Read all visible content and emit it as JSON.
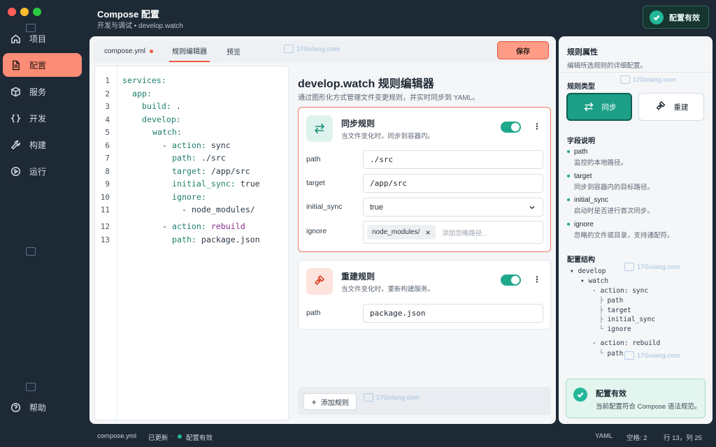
{
  "window": {
    "title": "Compose 配置",
    "subtitle": "开发与调试 • develop.watch"
  },
  "header": {
    "valid_label": "配置有效"
  },
  "sidebar": {
    "items": [
      {
        "label": "项目",
        "icon": "home-icon"
      },
      {
        "label": "配置",
        "icon": "document-icon"
      },
      {
        "label": "服务",
        "icon": "cube-icon"
      },
      {
        "label": "开发",
        "icon": "code-braces-icon"
      },
      {
        "label": "构建",
        "icon": "wrench-icon"
      },
      {
        "label": "运行",
        "icon": "play-circle-icon"
      }
    ],
    "help": "帮助"
  },
  "tabs": {
    "file": "compose.yml",
    "rules": "规则编辑器",
    "preview": "预览",
    "save": "保存"
  },
  "code": {
    "lines": [
      "1",
      "2",
      "3",
      "4",
      "5",
      "6",
      "7",
      "8",
      "9",
      "10",
      "11",
      "12",
      "13"
    ],
    "l1": "services:",
    "l2": "app:",
    "l3k": "build:",
    "l3v": " .",
    "l4": "develop:",
    "l5": "watch:",
    "l6a": "- ",
    "l6k": "action:",
    "l6v": " sync",
    "l7k": "path:",
    "l7v": " ./src",
    "l8k": "target:",
    "l8v": " /app/src",
    "l9k": "initial_sync:",
    "l9v": " true",
    "l10k": "ignore:",
    "l11": "- node_modules/",
    "l12a": "- ",
    "l12k": "action:",
    "l12v": " rebuild",
    "l13k": "path:",
    "l13v": " package.json"
  },
  "rules": {
    "title": "develop.watch 规则编辑器",
    "subtitle": "通过图形化方式管理文件变更规则，并实时同步到 YAML。",
    "sync": {
      "title": "同步规则",
      "desc": "当文件变化时，同步到容器内。",
      "enabled": true,
      "path_label": "path",
      "path": "./src",
      "target_label": "target",
      "target": "/app/src",
      "initial_sync_label": "initial_sync",
      "initial_sync": "true",
      "ignore_label": "ignore",
      "ignore_chip": "node_modules/",
      "ignore_placeholder": "添加忽略路径..."
    },
    "rebuild": {
      "title": "重建规则",
      "desc": "当文件变化时，重新构建服务。",
      "enabled": true,
      "path_label": "path",
      "path": "package.json"
    },
    "add": "添加规则"
  },
  "props": {
    "title": "规则属性",
    "subtitle": "编辑所选规则的详细配置。",
    "type_label": "规则类型",
    "type_sync": "同步",
    "type_rebuild": "重建",
    "fields_label": "字段说明",
    "fields": [
      {
        "name": "path",
        "desc": "监控的本地路径。"
      },
      {
        "name": "target",
        "desc": "同步到容器内的目标路径。"
      },
      {
        "name": "initial_sync",
        "desc": "启动时是否进行首次同步。"
      },
      {
        "name": "ignore",
        "desc": "忽略的文件或目录，支持通配符。"
      }
    ],
    "structure_label": "配置结构",
    "tree": {
      "develop": "develop",
      "watch": "watch",
      "sync": "action: sync",
      "path": "path",
      "target": "target",
      "initial_sync": "initial_sync",
      "ignore": "ignore",
      "rebuild": "action: rebuild",
      "path2": "path"
    },
    "status_title": "配置有效",
    "status_desc": "当前配置符合 Compose 语法规范。"
  },
  "statusbar": {
    "file": "compose.yml",
    "updated": "已更新",
    "sep": "·",
    "valid": "配置有效",
    "lang": "YAML",
    "spaces": "空格: 2",
    "pos": "行 13，列 25"
  },
  "watermark": "17Golang.com",
  "colors": {
    "accent": "#fb8c75",
    "teal": "#1fa88c",
    "danger": "#f05b40"
  }
}
